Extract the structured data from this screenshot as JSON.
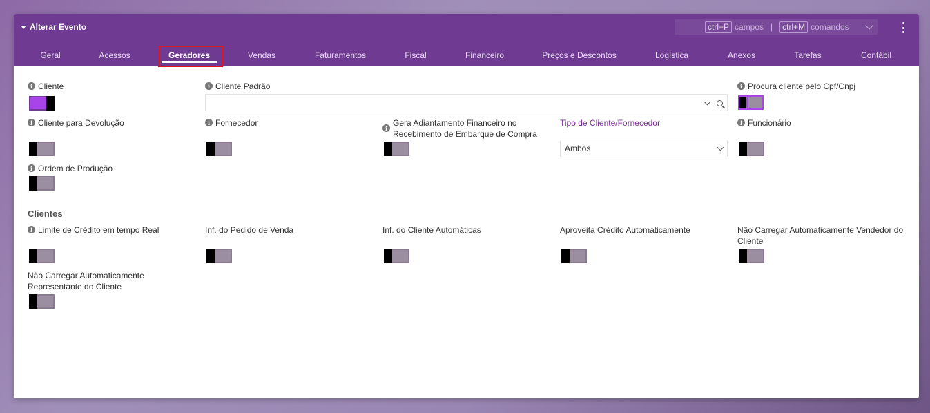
{
  "window": {
    "title": "Alterar Evento",
    "shortcut_fields_key": "ctrl+P",
    "shortcut_fields_label": "campos",
    "shortcut_sep": "|",
    "shortcut_commands_key": "ctrl+M",
    "shortcut_commands_label": "comandos"
  },
  "tabs": [
    {
      "label": "Geral"
    },
    {
      "label": "Acessos"
    },
    {
      "label": "Geradores",
      "active": true
    },
    {
      "label": "Vendas"
    },
    {
      "label": "Faturamentos"
    },
    {
      "label": "Fiscal"
    },
    {
      "label": "Financeiro"
    },
    {
      "label": "Preços e Descontos"
    },
    {
      "label": "Logística"
    },
    {
      "label": "Anexos"
    },
    {
      "label": "Tarefas"
    },
    {
      "label": "Contábil"
    }
  ],
  "fields": {
    "cliente": {
      "label": "Cliente",
      "value": true
    },
    "cliente_padrao": {
      "label": "Cliente Padrão",
      "value": ""
    },
    "procura_cliente": {
      "label": "Procura cliente pelo Cpf/Cnpj",
      "value": false
    },
    "cliente_devolucao": {
      "label": "Cliente para Devolução",
      "value": false
    },
    "fornecedor": {
      "label": "Fornecedor",
      "value": false
    },
    "gera_adiantamento_1": {
      "label": "Gera Adiantamento Financeiro no"
    },
    "gera_adiantamento_2": {
      "label": "Recebimento de Embarque de Compra",
      "value": false
    },
    "tipo_cliente": {
      "label": "Tipo de Cliente/Fornecedor",
      "value": "Ambos"
    },
    "funcionario": {
      "label": "Funcionário",
      "value": false
    },
    "ordem_producao": {
      "label": "Ordem de Produção",
      "value": false
    }
  },
  "clientes_section": {
    "title": "Clientes",
    "limite_credito": {
      "label": "Limite de Crédito em tempo Real",
      "value": false
    },
    "inf_pedido": {
      "label": "Inf. do Pedido de Venda",
      "value": false
    },
    "inf_cliente": {
      "label": "Inf. do Cliente Automáticas",
      "value": false
    },
    "aproveita_credito": {
      "label": "Aproveita Crédito Automaticamente",
      "value": false
    },
    "nao_carregar_vendedor_1": {
      "label": "Não Carregar Automaticamente Vendedor do"
    },
    "nao_carregar_vendedor_2": {
      "label": "Cliente",
      "value": false
    },
    "nao_carregar_representante_1": {
      "label": "Não Carregar Automaticamente"
    },
    "nao_carregar_representante_2": {
      "label": "Representante do Cliente",
      "value": false
    }
  },
  "colors": {
    "header": "#6f3a91",
    "accent": "#a844e8",
    "highlight": "#e0161e"
  }
}
